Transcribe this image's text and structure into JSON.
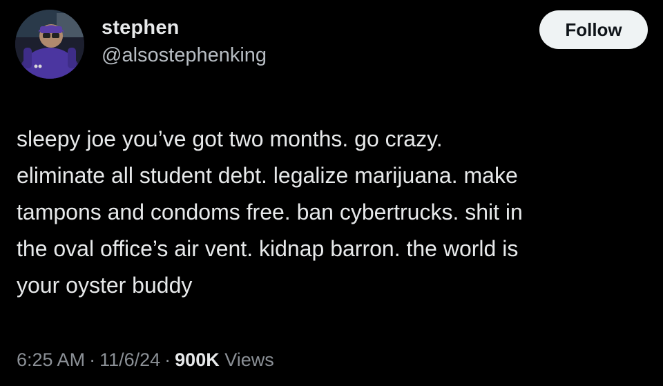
{
  "author": {
    "display_name": "stephen",
    "handle": "@alsostephenking"
  },
  "follow_button": {
    "label": "Follow"
  },
  "tweet": {
    "text": "sleepy joe you’ve got two months. go crazy.\neliminate all student debt. legalize marijuana. make\ntampons and condoms free. ban cybertrucks. shit in\nthe oval office’s air vent. kidnap barron. the world is\nyour oyster buddy"
  },
  "meta": {
    "time": "6:25 AM",
    "date": "11/6/24",
    "separator": "·",
    "views_count": "900K",
    "views_label": "Views"
  },
  "colors": {
    "background": "#000000",
    "primary_text": "#e7e9ea",
    "secondary_text": "#8b9096",
    "follow_bg": "#eff3f4",
    "follow_text": "#0f1419"
  }
}
